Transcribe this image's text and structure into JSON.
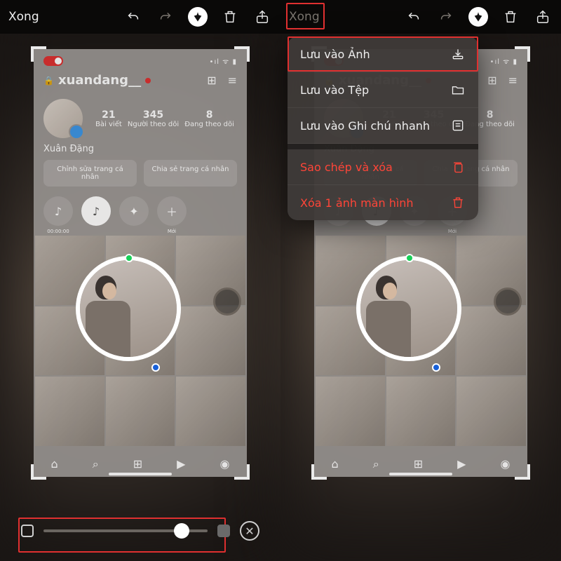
{
  "toolbar": {
    "done": "Xong",
    "icons": {
      "undo": "undo-icon",
      "redo": "redo-icon",
      "pen": "pen-icon",
      "trash": "trash-icon",
      "share": "share-icon"
    }
  },
  "instagram": {
    "handle": "xuandang__",
    "display_name": "Xuân Đặng",
    "stats": {
      "posts": {
        "n": "21",
        "lbl": "Bài viết"
      },
      "followers": {
        "n": "345",
        "lbl": "Người theo dõi"
      },
      "following": {
        "n": "8",
        "lbl": "Đang theo dõi"
      }
    },
    "edit_profile": "Chỉnh sửa trang cá nhân",
    "share_profile": "Chia sẻ trang cá nhân",
    "story_new": "Mới",
    "story_time": "00:00:00"
  },
  "slider": {
    "value": 88
  },
  "menu": {
    "save_photos": "Lưu vào Ảnh",
    "save_files": "Lưu vào Tệp",
    "save_quicknote": "Lưu vào Ghi chú nhanh",
    "copy_delete": "Sao chép và xóa",
    "delete_one": "Xóa 1 ảnh màn hình"
  }
}
